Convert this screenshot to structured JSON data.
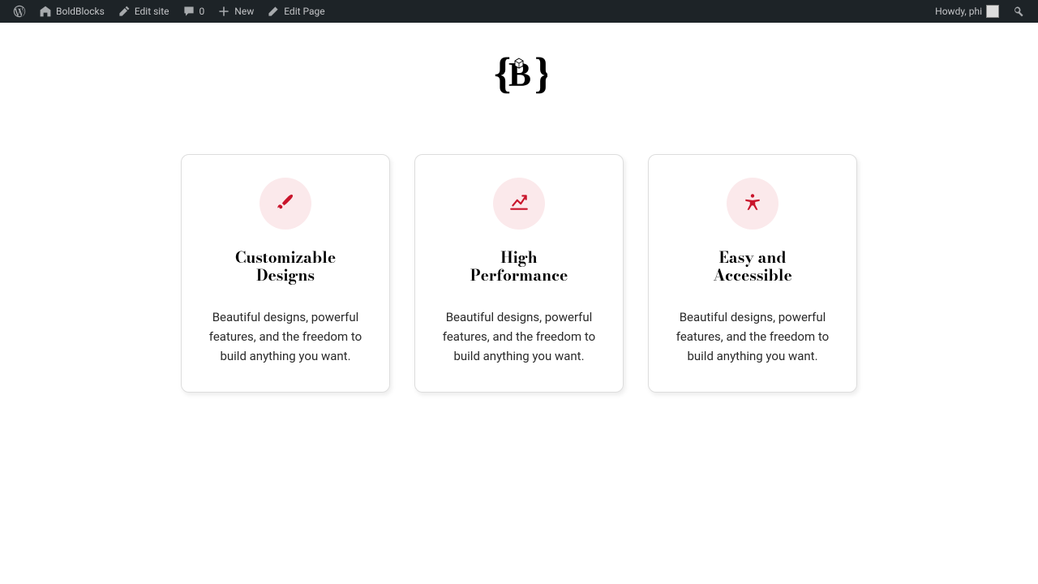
{
  "adminBar": {
    "siteName": "BoldBlocks",
    "editSite": "Edit site",
    "commentsCount": "0",
    "newLabel": "New",
    "editPage": "Edit Page",
    "greeting": "Howdy, phi"
  },
  "cards": [
    {
      "titleLine1": "Customizable",
      "titleLine2": "Designs",
      "body": "Beautiful designs, powerful features, and the freedom to build anything you want."
    },
    {
      "titleLine1": "High",
      "titleLine2": "Performance",
      "body": "Beautiful designs, powerful features, and the freedom to build anything you want."
    },
    {
      "titleLine1": "Easy and",
      "titleLine2": "Accessible",
      "body": "Beautiful designs, powerful features, and the freedom to build anything you want."
    }
  ]
}
